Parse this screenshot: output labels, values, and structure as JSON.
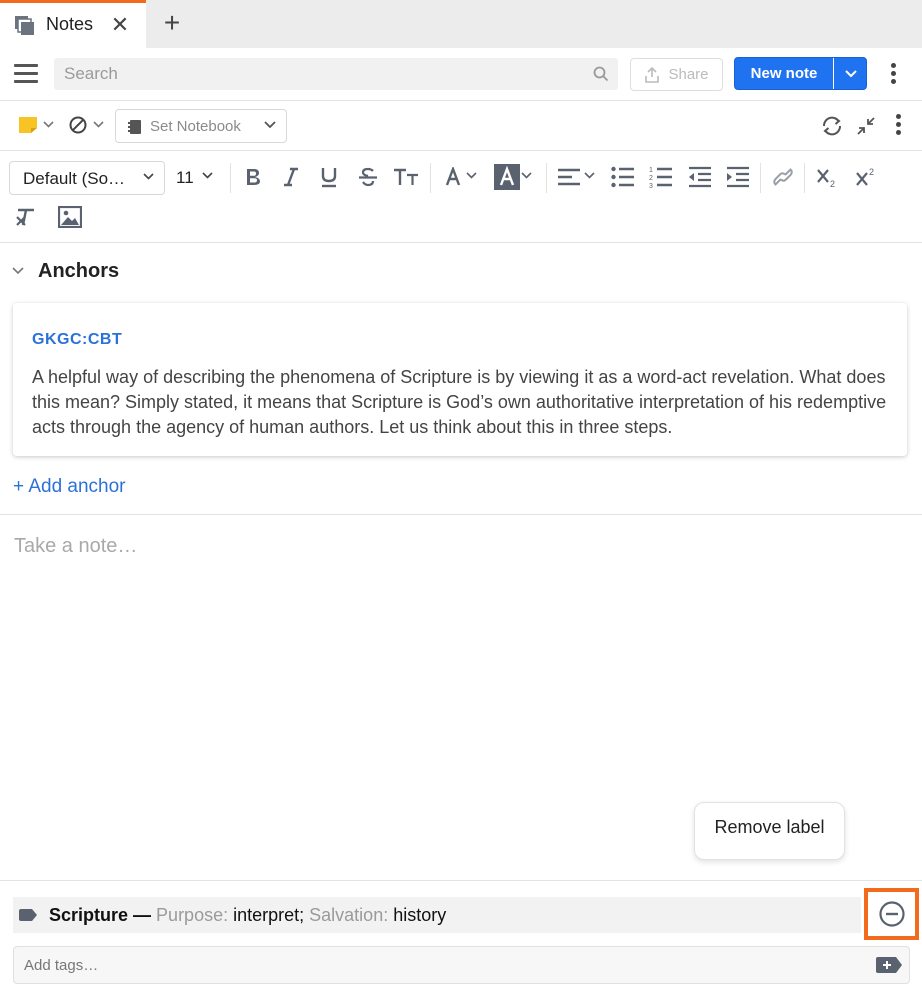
{
  "tabs": [
    {
      "label": "Notes"
    }
  ],
  "header": {
    "search_placeholder": "Search",
    "share_label": "Share",
    "new_note_label": "New note"
  },
  "note_toolbar": {
    "notebook_label": "Set Notebook"
  },
  "format_toolbar": {
    "font_family": "Default (So…",
    "font_size": "11"
  },
  "anchors": {
    "title": "Anchors",
    "items": [
      {
        "reference": "GKGC:CBT",
        "text": "A helpful way of describing the phenomena of Scripture is by viewing it as a word-act revelation. What does this mean? Simply stated, it means that Scripture is God’s own authoritative interpretation of his redemptive acts through the agency of human authors. Let us think about this in three steps."
      }
    ],
    "add_label": "+ Add anchor"
  },
  "note": {
    "placeholder": "Take a note…"
  },
  "label": {
    "name": "Scripture",
    "separator": " — ",
    "key1": "Purpose:",
    "val1": " interpret",
    "sep2": "; ",
    "key2": "Salvation:",
    "val2": " history"
  },
  "tooltip": {
    "text": "Remove label"
  },
  "tags": {
    "placeholder": "Add tags…"
  },
  "colors": {
    "accent_orange": "#f26b1d",
    "primary_blue": "#1f73f0",
    "link_blue": "#2b72d8",
    "sticky_yellow": "#f7c325"
  }
}
